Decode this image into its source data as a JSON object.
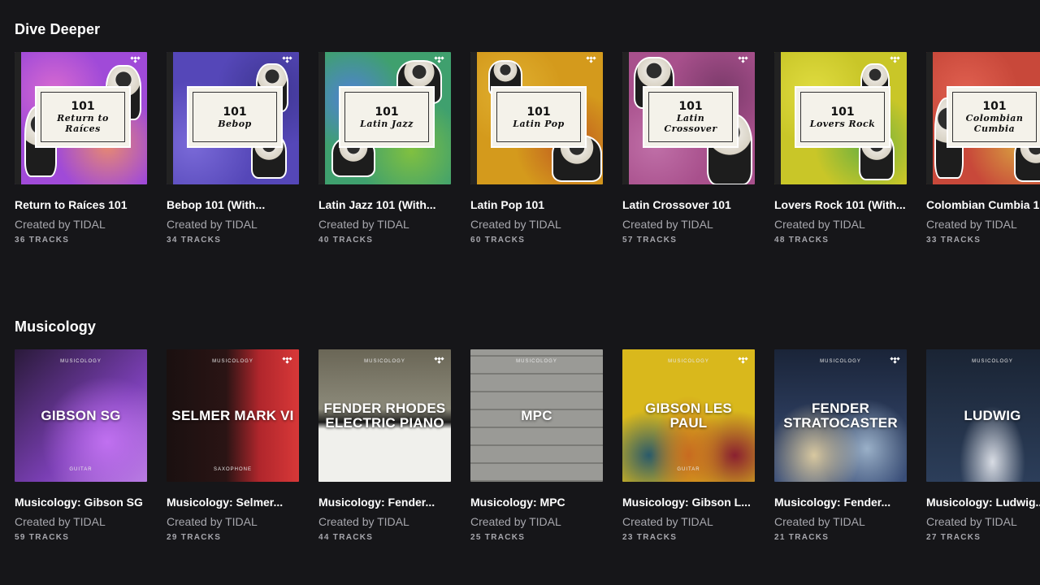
{
  "dive_deeper": {
    "title": "Dive Deeper",
    "cards": [
      {
        "art_num": "101",
        "art_name": "Return to Raíces",
        "title": "Return to Raíces 101",
        "creator": "Created by TIDAL",
        "tracks": "36 TRACKS",
        "color": "#a04ad8"
      },
      {
        "art_num": "101",
        "art_name": "Bebop",
        "title": "Bebop 101 (With...",
        "creator": "Created by TIDAL",
        "tracks": "34 TRACKS",
        "color": "#5547b8"
      },
      {
        "art_num": "101",
        "art_name": "Latin Jazz",
        "title": "Latin Jazz 101 (With...",
        "creator": "Created by TIDAL",
        "tracks": "40 TRACKS",
        "color": "#3fa06e"
      },
      {
        "art_num": "101",
        "art_name": "Latin Pop",
        "title": "Latin Pop 101",
        "creator": "Created by TIDAL",
        "tracks": "60 TRACKS",
        "color": "#d49a1c"
      },
      {
        "art_num": "101",
        "art_name": "Latin Crossover",
        "title": "Latin Crossover 101",
        "creator": "Created by TIDAL",
        "tracks": "57 TRACKS",
        "color": "#a8508c"
      },
      {
        "art_num": "101",
        "art_name": "Lovers Rock",
        "title": "Lovers Rock 101 (With...",
        "creator": "Created by TIDAL",
        "tracks": "48 TRACKS",
        "color": "#c9c628"
      },
      {
        "art_num": "101",
        "art_name": "Colombian Cumbia",
        "title": "Colombian Cumbia 1",
        "creator": "Created by TIDAL",
        "tracks": "33 TRACKS",
        "color": "#c8483a"
      }
    ]
  },
  "musicology": {
    "title": "Musicology",
    "art_label": "MUSICOLOGY",
    "cards": [
      {
        "art_name": "GIBSON SG",
        "art_foot": "GUITAR",
        "title": "Musicology: Gibson SG",
        "creator": "Created by TIDAL",
        "tracks": "59 TRACKS",
        "color": "#7a3fb4"
      },
      {
        "art_name": "SELMER MARK VI",
        "art_foot": "SAXOPHONE",
        "title": "Musicology: Selmer...",
        "creator": "Created by TIDAL",
        "tracks": "29 TRACKS",
        "color": "#b0262c"
      },
      {
        "art_name": "FENDER RHODES ELECTRIC PIANO",
        "art_foot": "",
        "title": "Musicology: Fender...",
        "creator": "Created by TIDAL",
        "tracks": "44 TRACKS",
        "color": "#8c8a7a"
      },
      {
        "art_name": "MPC",
        "art_foot": "",
        "title": "Musicology: MPC",
        "creator": "Created by TIDAL",
        "tracks": "25 TRACKS",
        "color": "#9a9a96"
      },
      {
        "art_name": "GIBSON LES PAUL",
        "art_foot": "GUITAR",
        "title": "Musicology: Gibson L...",
        "creator": "Created by TIDAL",
        "tracks": "23 TRACKS",
        "color": "#d9b81c"
      },
      {
        "art_name": "FENDER STRATOCASTER",
        "art_foot": "",
        "title": "Musicology: Fender...",
        "creator": "Created by TIDAL",
        "tracks": "21 TRACKS",
        "color": "#3a4f7a"
      },
      {
        "art_name": "LUDWIG",
        "art_foot": "",
        "title": "Musicology: Ludwig...",
        "creator": "Created by TIDAL",
        "tracks": "27 TRACKS",
        "color": "#2c3e5a"
      }
    ]
  }
}
